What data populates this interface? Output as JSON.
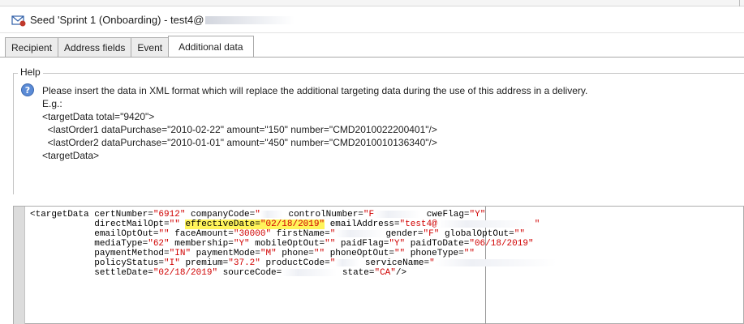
{
  "window": {
    "title": "Seed 'Sprint 1 (Onboarding) - test4@",
    "icon": "mail-seed-icon"
  },
  "tabs": [
    {
      "label": "Recipient",
      "active": false
    },
    {
      "label": "Address fields",
      "active": false
    },
    {
      "label": "Event",
      "active": false
    },
    {
      "label": "Additional data",
      "active": true
    }
  ],
  "help": {
    "legend": "Help",
    "icon": "question-icon",
    "lines": [
      "Please insert the data in XML format which will replace the additional targeting data during the use of this address in a delivery.",
      "E.g.:",
      "<targetData total=\"9420\">",
      "  <lastOrder1 dataPurchase=\"2010-02-22\" amount=\"150\" number=\"CMD2010022200401\"/>",
      "  <lastOrder2 dataPurchase=\"2010-01-01\" amount=\"450\" number=\"CMD2010010136340\"/>",
      "<targetData>"
    ]
  },
  "xml": {
    "line1": {
      "prefix": "<targetData certNumber=",
      "certNumber": "\"6912\"",
      "companyCode_label": " companyCode=",
      "companyCode": "\"",
      "controlNumber_label": " controlNumber=",
      "controlNumber": "\"F",
      "cweFlag_label": " cweFlag=",
      "cweFlag": "\"Y\""
    },
    "line2": {
      "indent": "            directMailOpt=",
      "directMailOpt": "\"\"",
      "effectiveDate_label": "effectiveDate=",
      "effectiveDate": "\"02/18/2019\"",
      "emailAddress_label": " emailAddress=",
      "emailAddress": "\"test4@",
      "emailAddress_end": "\""
    },
    "line3": {
      "indent": "            emailOptOut=",
      "emailOptOut": "\"\"",
      "faceAmount_label": " faceAmount=",
      "faceAmount": "\"30000\"",
      "firstName_label": " firstName=",
      "firstName": "\"",
      "gender_label": "gender=",
      "gender": "\"F\"",
      "globalOptOut_label": " globalOptOut=",
      "globalOptOut": "\"\""
    },
    "line4": {
      "indent": "            mediaType=",
      "mediaType": "\"62\"",
      "membership_label": " membership=",
      "membership": "\"Y\"",
      "mobileOptOut_label": " mobileOptOut=",
      "mobileOptOut": "\"\"",
      "paidFlag_label": " paidFlag=",
      "paidFlag": "\"Y\"",
      "paidToDate_label": " paidToDate=",
      "paidToDate": "\"06/18/2019\""
    },
    "line5": {
      "indent": "            paymentMethod=",
      "paymentMethod": "\"IN\"",
      "paymentMode_label": " paymentMode=",
      "paymentMode": "\"M\"",
      "phone_label": " phone=",
      "phone": "\"\"",
      "phoneOptOut_label": " phoneOptOut=",
      "phoneOptOut": "\"\"",
      "phoneType_label": " phoneType=",
      "phoneType": "\"\""
    },
    "line6": {
      "indent": "            policyStatus=",
      "policyStatus": "\"I\"",
      "premium_label": " premium=",
      "premium": "\"37.2\"",
      "productCode_label": " productCode=",
      "productCode": "\"",
      "serviceName_label": " serviceName=",
      "serviceName": "\""
    },
    "line7": {
      "indent": "            settleDate=",
      "settleDate": "\"02/18/2019\"",
      "sourceCode_label": " sourceCode=",
      "state_label": " state=",
      "state": "\"CA\"",
      "close": "/>"
    }
  },
  "colors": {
    "xml_value": "#d00000",
    "highlight": "#fff45a"
  }
}
